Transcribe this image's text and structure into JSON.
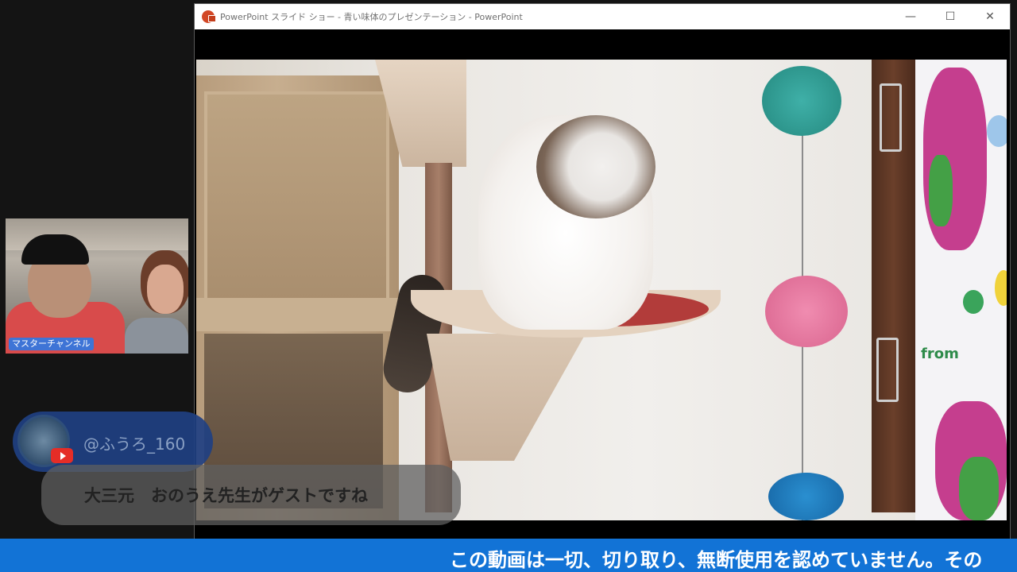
{
  "window": {
    "title": "PowerPoint スライド ショー - 青い味体のプレゼンテーション - PowerPoint",
    "controls": {
      "minimize": "—",
      "maximize": "☐",
      "close": "✕"
    }
  },
  "webcam": {
    "label": "マスターチャンネル"
  },
  "chat": {
    "username": "@ふうろ_160",
    "message": "大三元　おのうえ先生がゲストですね"
  },
  "slide": {
    "curtain_text": "from"
  },
  "ticker": {
    "text": "この動画は一切、切り取り、無断使用を認めていません。その"
  },
  "colors": {
    "ticker_bg": "#1273d6",
    "chat_name_pill": "#20408e",
    "youtube_red": "#e52d27"
  }
}
